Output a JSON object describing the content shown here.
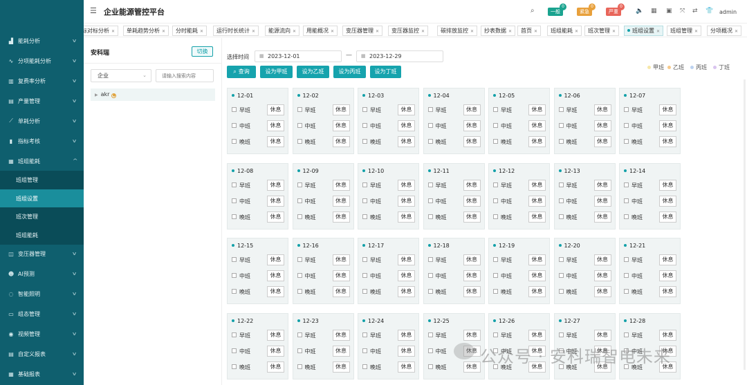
{
  "app": {
    "title": "企业能源管控平台",
    "user": "admin"
  },
  "alerts": [
    {
      "label": "一般",
      "count": "0",
      "color": "#1aa38f"
    },
    {
      "label": "紧急",
      "count": "0",
      "color": "#e8a03b"
    },
    {
      "label": "严重",
      "count": "0",
      "color": "#e8655a"
    }
  ],
  "sidebar": {
    "items": [
      {
        "label": "能耗分析",
        "icon": "bar-chart-icon"
      },
      {
        "label": "分项能耗分析",
        "icon": "trend-icon"
      },
      {
        "label": "复费率分析",
        "icon": "building-icon"
      },
      {
        "label": "产量管理",
        "icon": "document-icon"
      },
      {
        "label": "单耗分析",
        "icon": "line-icon"
      },
      {
        "label": "指标考核",
        "icon": "column-icon"
      },
      {
        "label": "班组能耗",
        "icon": "grid-icon"
      }
    ],
    "sub_items": [
      {
        "label": "班组管理"
      },
      {
        "label": "班组设置"
      },
      {
        "label": "班次管理"
      },
      {
        "label": "班组能耗"
      }
    ],
    "lower_items": [
      {
        "label": "变压器管理",
        "icon": "transformer-icon"
      },
      {
        "label": "AI预测",
        "icon": "people-icon"
      },
      {
        "label": "智能照明",
        "icon": "bulb-icon"
      },
      {
        "label": "组态管理",
        "icon": "keyboard-icon"
      },
      {
        "label": "视频管理",
        "icon": "camera-icon"
      },
      {
        "label": "自定义报表",
        "icon": "report-icon"
      },
      {
        "label": "基础报表",
        "icon": "table-icon"
      }
    ]
  },
  "tabs": [
    {
      "label": "标对标分析"
    },
    {
      "label": "单耗趋势分析"
    },
    {
      "label": "分时能耗"
    },
    {
      "label": "运行时长统计"
    },
    {
      "label": "能源流向"
    },
    {
      "label": "用能概况"
    },
    {
      "label": "变压器管理"
    },
    {
      "label": "变压器监控"
    },
    {
      "label": "碳排放监控"
    },
    {
      "label": "抄表数据"
    },
    {
      "label": "首页"
    },
    {
      "label": "班组能耗"
    },
    {
      "label": "班次管理"
    },
    {
      "label": "班组设置"
    },
    {
      "label": "班组管理"
    },
    {
      "label": "分项概况"
    }
  ],
  "left_panel": {
    "title": "安科瑞",
    "switch_label": "切换",
    "select_value": "企业",
    "search_placeholder": "请输入搜索内容",
    "tree_node": "akr"
  },
  "filter": {
    "date_label": "选择时间",
    "start_date": "2023-12-01",
    "end_date": "2023-12-29",
    "separator": "—"
  },
  "actions": [
    {
      "label": "查询",
      "icon": "search-icon"
    },
    {
      "label": "设为甲班"
    },
    {
      "label": "设为乙班"
    },
    {
      "label": "设为丙班"
    },
    {
      "label": "设为丁班"
    }
  ],
  "legend": [
    {
      "label": "甲班",
      "color": "#f6e7a8"
    },
    {
      "label": "乙班",
      "color": "#f6c98a"
    },
    {
      "label": "丙班",
      "color": "#bcd2f0"
    },
    {
      "label": "丁班",
      "color": "#d9c4ef"
    }
  ],
  "shift_labels": [
    "早班",
    "中班",
    "晚班"
  ],
  "rest_label": "休息",
  "days": [
    "12-01",
    "12-02",
    "12-03",
    "12-04",
    "12-05",
    "12-06",
    "12-07",
    "12-08",
    "12-09",
    "12-10",
    "12-11",
    "12-12",
    "12-13",
    "12-14",
    "12-15",
    "12-16",
    "12-17",
    "12-18",
    "12-19",
    "12-20",
    "12-21",
    "12-22",
    "12-23",
    "12-24",
    "12-25",
    "12-26",
    "12-27",
    "12-28"
  ],
  "watermark": "公众号 · 安科瑞智电未来"
}
